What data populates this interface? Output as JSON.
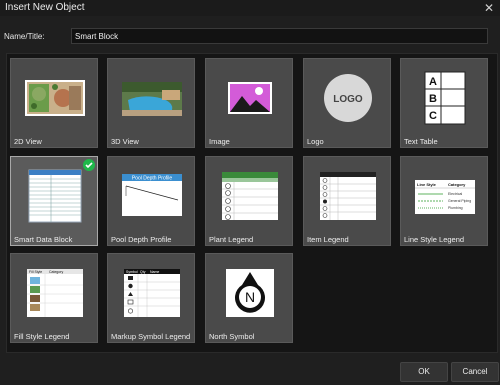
{
  "window": {
    "title": "Insert New Object",
    "close_glyph": "✕"
  },
  "name_field": {
    "label": "Name/Title:",
    "value": "Smart Block"
  },
  "objects": [
    {
      "label": "2D View",
      "icon": "plan-view-thumbnail"
    },
    {
      "label": "3D View",
      "icon": "pool-render-thumbnail"
    },
    {
      "label": "Image",
      "icon": "image-icon"
    },
    {
      "label": "Logo",
      "icon": "logo-icon",
      "text": "LOGO"
    },
    {
      "label": "Text Table",
      "icon": "text-table-icon",
      "letters": [
        "A",
        "B",
        "C"
      ]
    },
    {
      "label": "Smart Data Block",
      "icon": "data-block-thumbnail",
      "selected": true
    },
    {
      "label": "Pool Depth Profile",
      "icon": "pool-depth-thumbnail",
      "chart_title": "Pool Depth Profile"
    },
    {
      "label": "Plant Legend",
      "icon": "plant-legend-thumbnail"
    },
    {
      "label": "Item Legend",
      "icon": "item-legend-thumbnail"
    },
    {
      "label": "Line Style Legend",
      "icon": "line-style-legend-thumbnail",
      "headers": [
        "Line Style",
        "Category"
      ],
      "rows": [
        "Electrical",
        "General Piping",
        "Plumbing"
      ]
    },
    {
      "label": "Fill Style Legend",
      "icon": "fill-style-legend-thumbnail",
      "headers": [
        "Fill Style",
        "Category"
      ]
    },
    {
      "label": "Markup Symbol Legend",
      "icon": "markup-symbol-legend-thumbnail",
      "headers": [
        "Symbol",
        "Qty",
        "Name"
      ]
    },
    {
      "label": "North Symbol",
      "icon": "north-arrow-icon",
      "letter": "N"
    }
  ],
  "buttons": {
    "ok": "OK",
    "cancel": "Cancel"
  },
  "colors": {
    "selected_check": "#1fb84a",
    "card_bg": "#4a4a4a",
    "accent_green": "#3a8a3a"
  }
}
